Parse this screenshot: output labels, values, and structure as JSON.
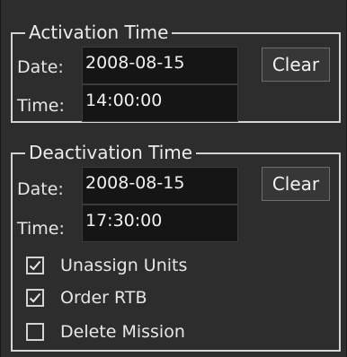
{
  "activation": {
    "title": "Activation Time",
    "date_label": "Date:",
    "date_value": "2008-08-15",
    "time_label": "Time:",
    "time_value": "14:00:00",
    "clear_label": "Clear"
  },
  "deactivation": {
    "title": "Deactivation Time",
    "date_label": "Date:",
    "date_value": "2008-08-15",
    "time_label": "Time:",
    "time_value": "17:30:00",
    "clear_label": "Clear",
    "options": [
      {
        "label": "Unassign Units",
        "checked": true
      },
      {
        "label": "Order RTB",
        "checked": true
      },
      {
        "label": "Delete Mission",
        "checked": false
      }
    ]
  },
  "colors": {
    "background": "#2d2d2d",
    "field_background": "#151515",
    "group_border": "#d4d4d4",
    "text": "#e6e6e6"
  },
  "icons": {
    "check": "check-icon"
  }
}
